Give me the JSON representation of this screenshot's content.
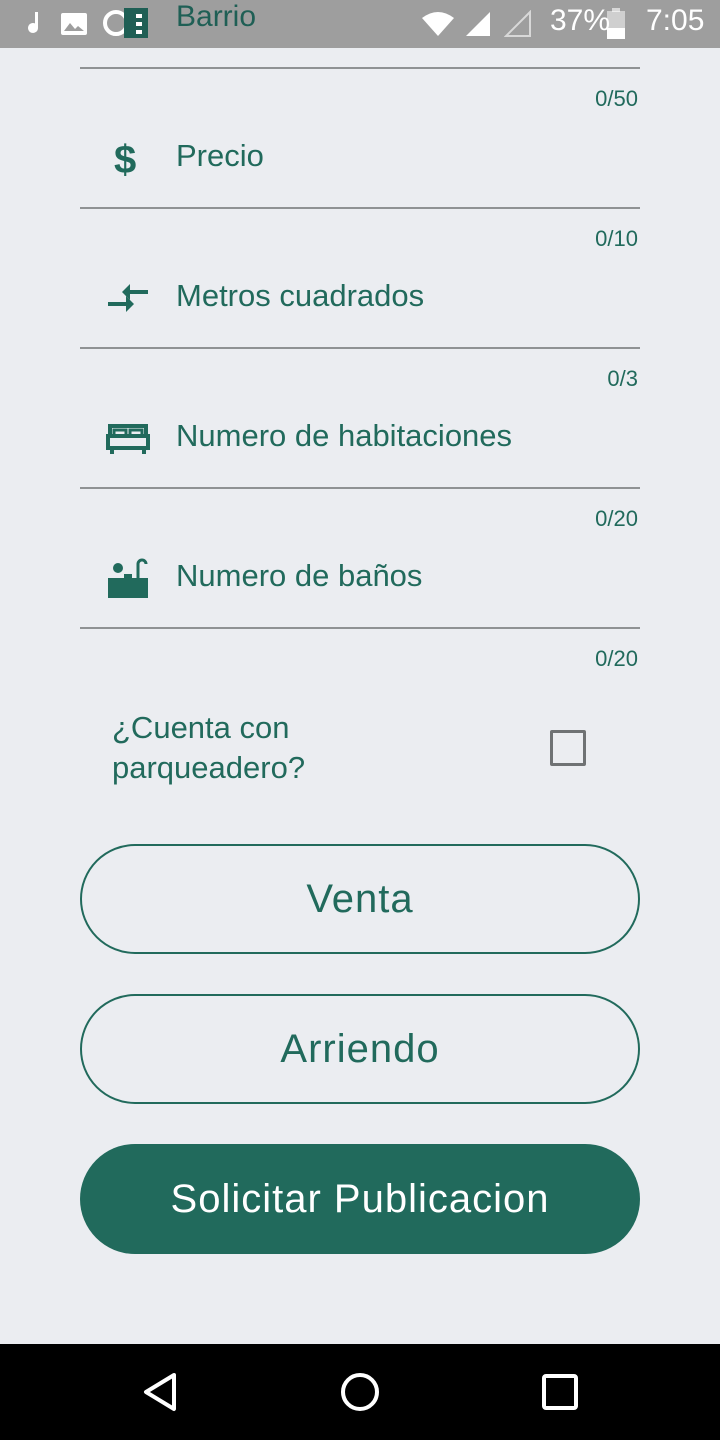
{
  "status_bar": {
    "background_title": "Barrio",
    "battery": "37%",
    "time": "7:05",
    "icons": [
      "music-note-icon",
      "image-icon",
      "app-notification-icon",
      "wifi-icon",
      "cell-signal-icon",
      "cell-signal-empty-icon",
      "battery-icon"
    ]
  },
  "form": {
    "top_counter": "0/50",
    "fields": [
      {
        "icon": "dollar-icon",
        "placeholder": "Precio",
        "counter": "0/10"
      },
      {
        "icon": "compare-arrows-icon",
        "placeholder": "Metros cuadrados",
        "counter": "0/3"
      },
      {
        "icon": "bed-icon",
        "placeholder": "Numero de habitaciones",
        "counter": "0/20"
      },
      {
        "icon": "bathtub-icon",
        "placeholder": "Numero de baños",
        "counter": "0/20"
      }
    ],
    "parking_label": "¿Cuenta con parqueadero?",
    "parking_checked": false
  },
  "buttons": {
    "sale": "Venta",
    "rent": "Arriendo",
    "submit": "Solicitar Publicacion"
  },
  "colors": {
    "accent": "#216a5c",
    "background": "#ebedf1",
    "status_bar": "#9e9e9e",
    "nav_bar": "#000000"
  },
  "nav_bar": {
    "icons": [
      "back-icon",
      "home-icon",
      "recents-icon"
    ]
  }
}
